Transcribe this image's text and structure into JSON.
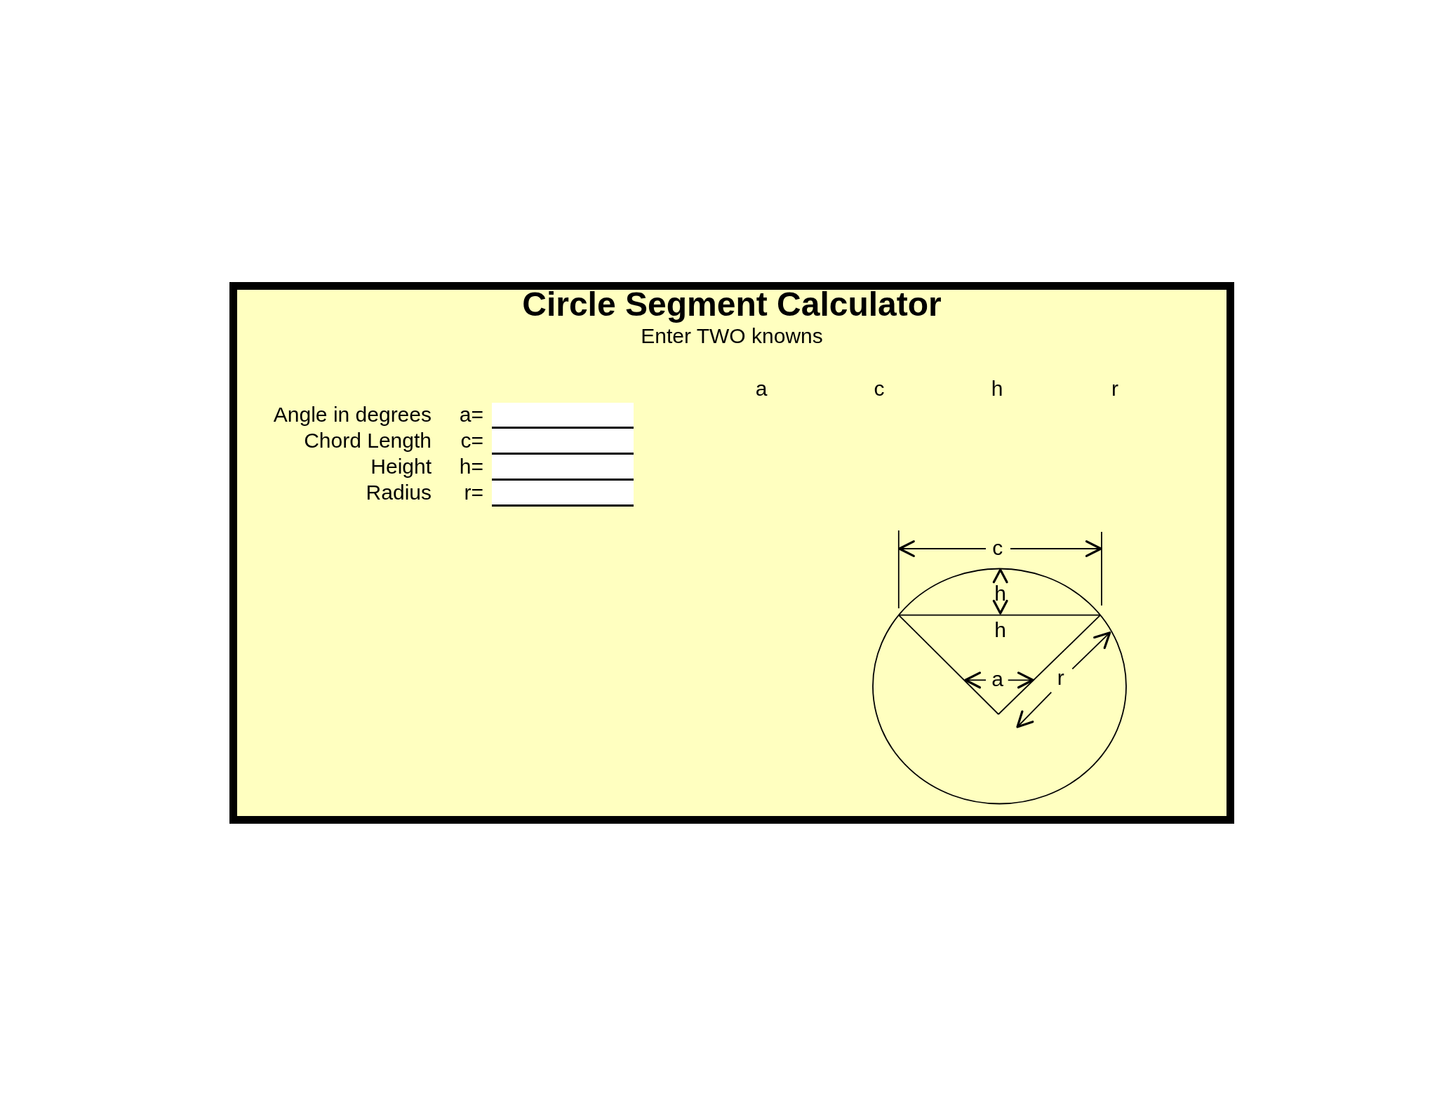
{
  "title": "Circle Segment Calculator",
  "subtitle": "Enter TWO knowns",
  "inputs": [
    {
      "label": "Angle in degrees",
      "symbol": "a="
    },
    {
      "label": "Chord Length",
      "symbol": "c="
    },
    {
      "label": "Height",
      "symbol": "h="
    },
    {
      "label": "Radius",
      "symbol": "r="
    }
  ],
  "result_columns": [
    "a",
    "c",
    "h",
    "r"
  ],
  "diagram": {
    "chord_label": "c",
    "height_label": "h",
    "height_label_lower": "h",
    "angle_label": "a",
    "radius_label": "r"
  }
}
